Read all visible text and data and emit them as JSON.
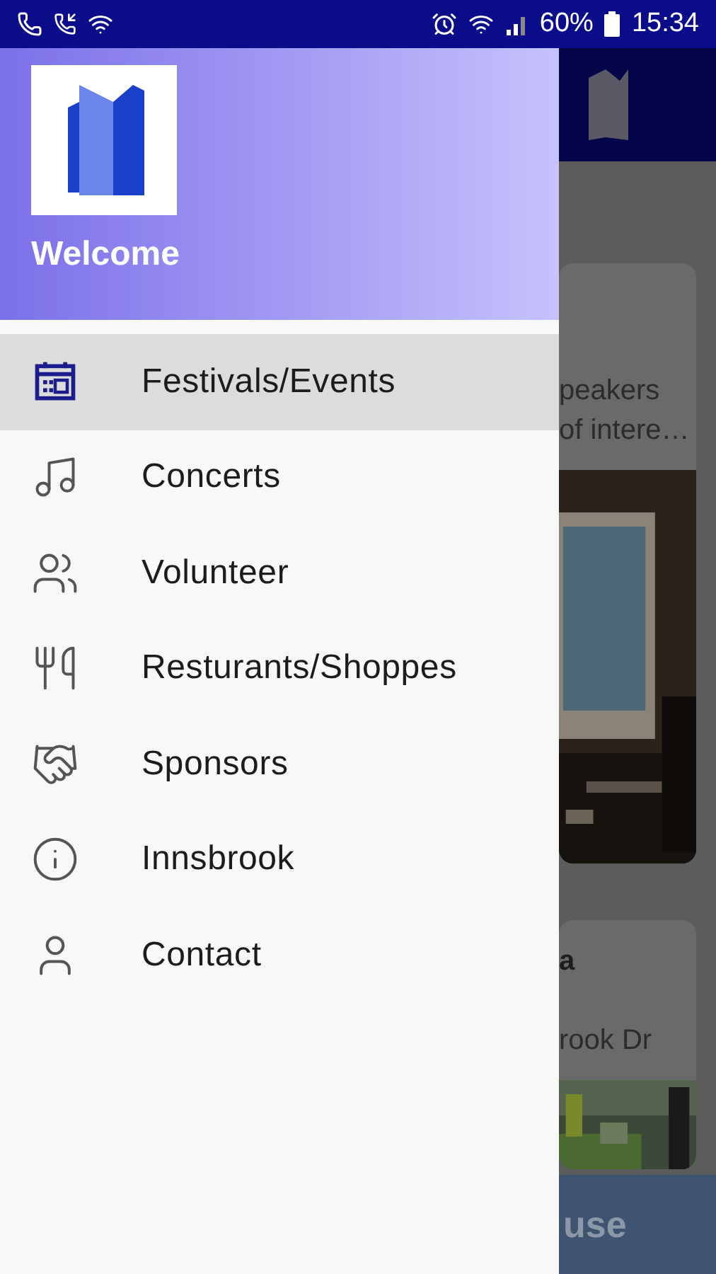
{
  "status_bar": {
    "battery": "60%",
    "time": "15:34"
  },
  "background": {
    "cards": [
      {
        "lines": [
          "peakers",
          "of intere…"
        ]
      },
      {
        "title": "a",
        "lines": [
          "rook Dr"
        ]
      }
    ],
    "bottom_button": "use"
  },
  "drawer": {
    "header": {
      "title": "Welcome"
    },
    "items": [
      {
        "label": "Festivals/Events",
        "selected": true
      },
      {
        "label": "Concerts",
        "selected": false
      },
      {
        "label": "Volunteer",
        "selected": false
      },
      {
        "label": "Resturants/Shoppes",
        "selected": false
      },
      {
        "label": "Sponsors",
        "selected": false
      },
      {
        "label": "Innsbrook",
        "selected": false
      },
      {
        "label": "Contact",
        "selected": false
      }
    ]
  }
}
